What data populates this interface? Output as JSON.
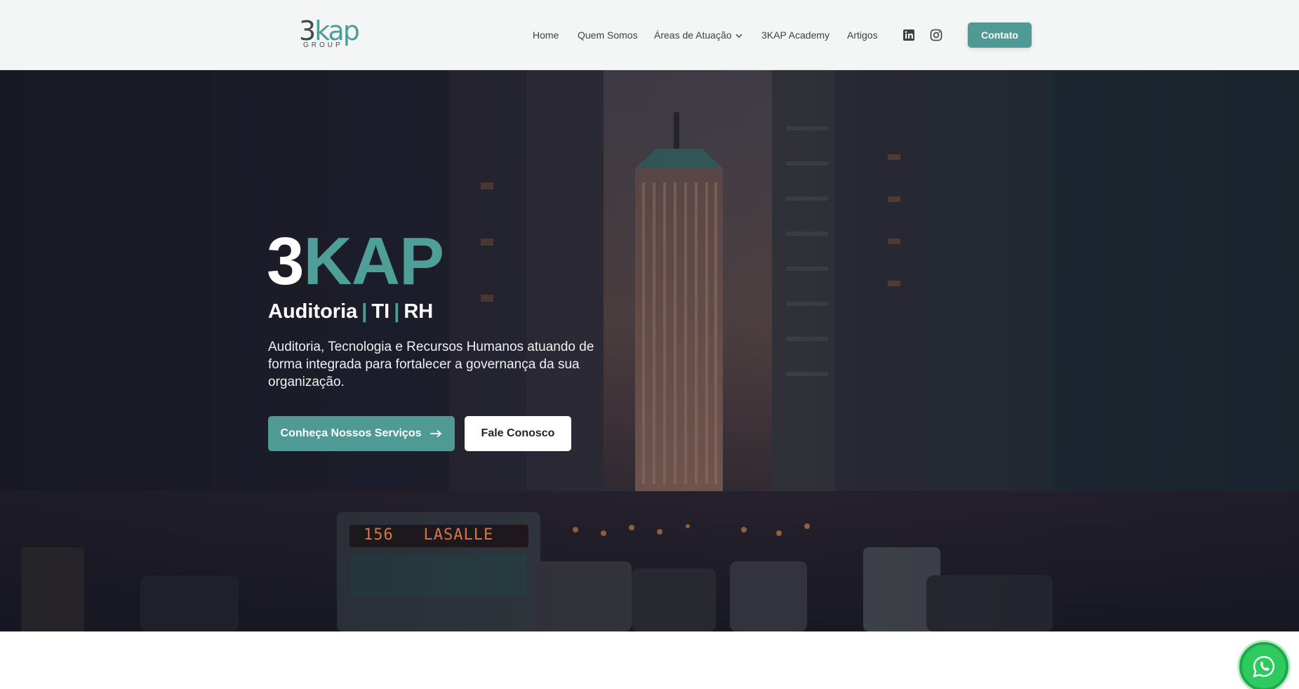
{
  "brand": {
    "logo_main_dark": "3",
    "logo_main_accent": "kap",
    "logo_group": "GROUP"
  },
  "nav": {
    "items": [
      {
        "label": "Home"
      },
      {
        "label": "Quem Somos"
      },
      {
        "label": "Áreas de Atuação"
      },
      {
        "label": "3KAP Academy"
      },
      {
        "label": "Artigos"
      }
    ],
    "social_icons": [
      "linkedin-icon",
      "instagram-icon"
    ],
    "cta_label": "Contato"
  },
  "hero": {
    "title_white": "3",
    "title_accent": "KAP",
    "subtitle_parts": [
      "Auditoria",
      "TI",
      "RH"
    ],
    "subtitle_separator": "|",
    "description": "Auditoria, Tecnologia e Recursos Humanos atuando de forma integrada para fortalecer a governança da sua organização.",
    "primary_button": "Conheça Nossos Serviços",
    "secondary_button": "Fale Conosco",
    "bus_sign_number": "156",
    "bus_sign_text": "LASALLE"
  },
  "floating": {
    "whatsapp_icon": "whatsapp-icon"
  },
  "colors": {
    "accent": "#4f9a94",
    "header_bg": "#f4f5f5",
    "hero_dark": "#262634",
    "whatsapp": "#2fca5f"
  }
}
